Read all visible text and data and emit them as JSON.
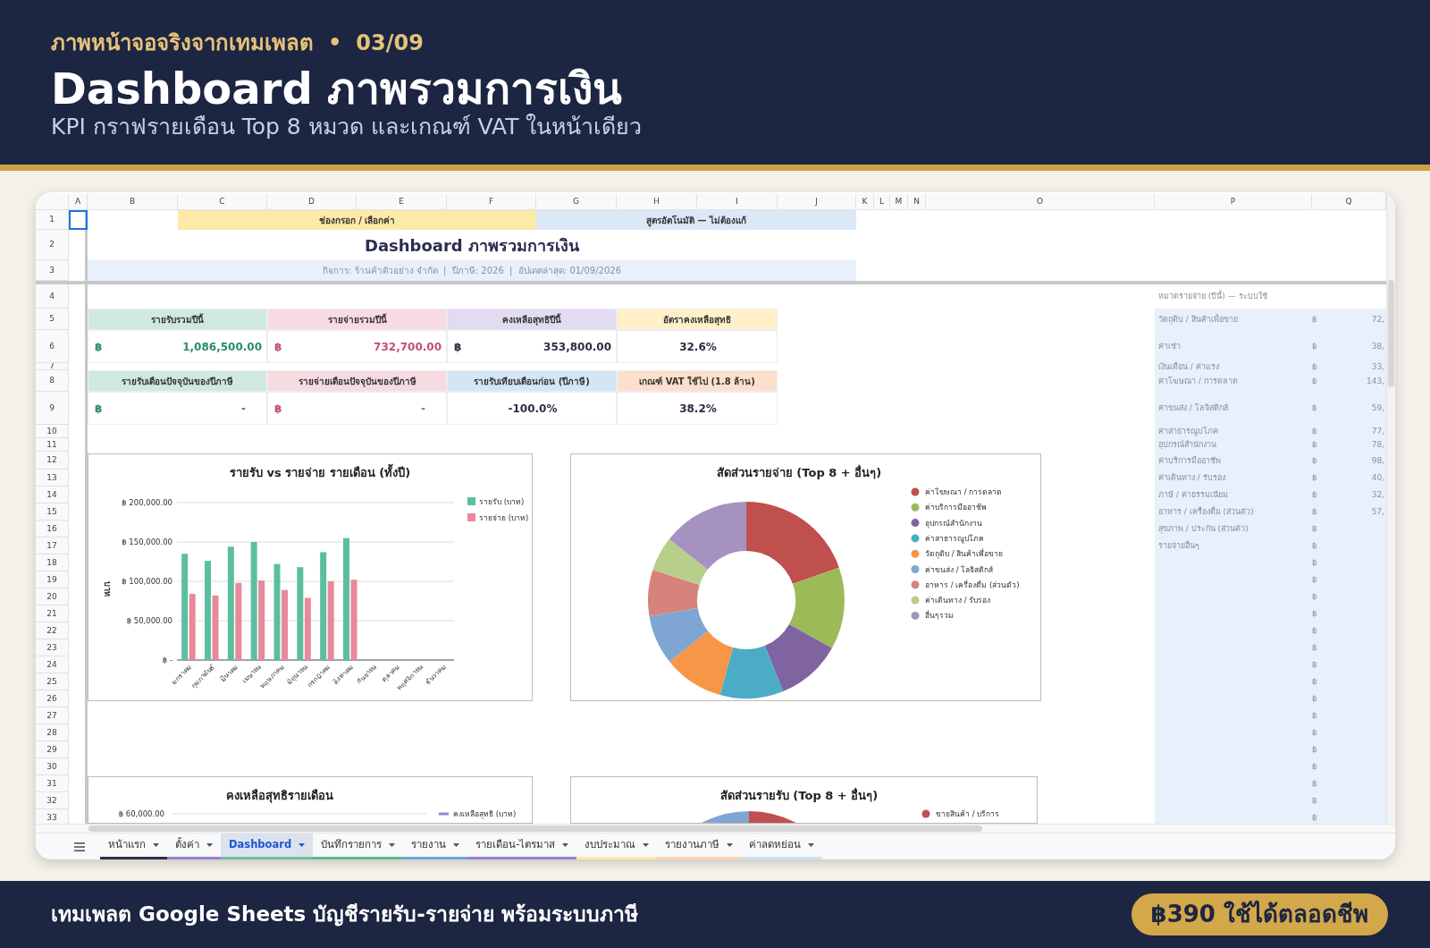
{
  "banner": {
    "kicker": "ภาพหน้าจอจริงจากเทมเพลต",
    "separator": "•",
    "counter": "03/09",
    "title": "Dashboard ภาพรวมการเงิน",
    "subtitle": "KPI กราฟรายเดือน Top 8 หมวด และเกณฑ์ VAT ในหน้าเดียว"
  },
  "sheet": {
    "columns": [
      "A",
      "B",
      "C",
      "D",
      "E",
      "F",
      "G",
      "H",
      "I",
      "J",
      "K",
      "L",
      "M",
      "N",
      "O",
      "P",
      "Q"
    ],
    "rows": [
      "1",
      "2",
      "3",
      "4",
      "5",
      "6",
      "7",
      "8",
      "9",
      "10",
      "11",
      "12",
      "13",
      "14",
      "15",
      "16",
      "17",
      "18",
      "19",
      "20",
      "21",
      "22",
      "23",
      "24",
      "25",
      "26",
      "27",
      "28",
      "29",
      "30",
      "31",
      "32",
      "33"
    ],
    "legend_cells": [
      {
        "text": "ช่องกรอก / เลือกค่า",
        "color": "#fde9a8"
      },
      {
        "text": "สูตรอัตโนมัติ — ไม่ต้องแก้",
        "color": "#dbe8f7"
      }
    ],
    "title": "Dashboard ภาพรวมการเงิน",
    "info": "กิจการ: ร้านค้าตัวอย่าง จำกัด  |  ปีภาษี: 2026  |  อัปเดตล่าสุด: 01/09/2026",
    "kpi_rows": [
      [
        {
          "label": "รายรับรวมปีนี้",
          "color": "#d0e9de",
          "kind": "income",
          "currency": "฿",
          "value": "1,086,500.00"
        },
        {
          "label": "รายจ่ายรวมปีนี้",
          "color": "#f8dbe1",
          "kind": "expense",
          "currency": "฿",
          "value": "732,700.00"
        },
        {
          "label": "คงเหลือสุทธิปีนี้",
          "color": "#e3dbf2",
          "kind": "plain",
          "currency": "฿",
          "value": "353,800.00"
        },
        {
          "label": "อัตราคงเหลือสุทธิ",
          "color": "#fff0c8",
          "kind": "plain",
          "value": "32.6%"
        }
      ],
      [
        {
          "label": "รายรับเดือนปัจจุบันของปีภาษี",
          "color": "#d0e9de",
          "kind": "income",
          "currency": "฿",
          "value": "-"
        },
        {
          "label": "รายจ่ายเดือนปัจจุบันของปีภาษี",
          "color": "#f8dbe1",
          "kind": "expense",
          "currency": "฿",
          "value": "-"
        },
        {
          "label": "รายรับเทียบเดือนก่อน (ปีภาษี)",
          "color": "#d4e6f4",
          "kind": "plain",
          "value": "-100.0%"
        },
        {
          "label": "เกณฑ์ VAT ใช้ไป (1.8 ล้าน)",
          "color": "#fde0cb",
          "kind": "plain",
          "value": "38.2%"
        }
      ]
    ],
    "charts": [
      {
        "kind": "bar",
        "chart_data": {
          "type": "bar",
          "title": "รายรับ vs รายจ่าย รายเดือน (ทั้งปี)",
          "ylabel": "บาท",
          "categories": [
            "มกราคม",
            "กุมภาพันธ์",
            "มีนาคม",
            "เมษายน",
            "พฤษภาคม",
            "มิถุนายน",
            "กรกฎาคม",
            "สิงหาคม",
            "กันยายน",
            "ตุลาคม",
            "พฤศจิกายน",
            "ธันวาคม"
          ],
          "series": [
            {
              "name": "รายรับ (บาท)",
              "color": "#5bbf9f",
              "values": [
                135000,
                126000,
                144000,
                150000,
                122000,
                118000,
                137000,
                155000,
                null,
                null,
                null,
                null
              ]
            },
            {
              "name": "รายจ่าย (บาท)",
              "color": "#e8899b",
              "values": [
                84000,
                82000,
                98000,
                101000,
                89000,
                79000,
                100000,
                102000,
                null,
                null,
                null,
                null
              ]
            }
          ],
          "ylim": [
            0,
            200000
          ],
          "grid": true,
          "legend": true,
          "yticks": [
            {
              "value": 0,
              "label": "฿ -"
            },
            {
              "value": 50000,
              "label": "฿ 50,000.00"
            },
            {
              "value": 100000,
              "label": "฿ 100,000.00"
            },
            {
              "value": 150000,
              "label": "฿ 150,000.00"
            },
            {
              "value": 200000,
              "label": "฿ 200,000.00"
            }
          ]
        }
      },
      {
        "kind": "donut",
        "title": "สัดส่วนรายจ่าย (Top 8 + อื่นๆ)",
        "legend": [
          {
            "label": "ค่าโฆษณา / การตลาด",
            "color": "#c0504d"
          },
          {
            "label": "ค่าบริการมืออาชีพ",
            "color": "#9bbb59"
          },
          {
            "label": "อุปกรณ์สำนักงาน",
            "color": "#8064a2"
          },
          {
            "label": "ค่าสาธารณูปโภค",
            "color": "#4bacc6"
          },
          {
            "label": "วัตถุดิบ / สินค้าเพื่อขาย",
            "color": "#f79646"
          },
          {
            "label": "ค่าขนส่ง / โลจิสติกส์",
            "color": "#7fa6d3"
          },
          {
            "label": "อาหาร / เครื่องดื่ม (ส่วนตัว)",
            "color": "#d6837c"
          },
          {
            "label": "ค่าเดินทาง / รับรอง",
            "color": "#b8cf8a"
          },
          {
            "label": "อื่นๆรวม",
            "color": "#a592c0"
          }
        ]
      },
      {
        "kind": "line",
        "title": "คงเหลือสุทธิรายเดือน",
        "ytick": "฿ 60,000.00",
        "legend": [
          {
            "label": "คงเหลือสุทธิ (บาท)",
            "color": "#9a84d6"
          }
        ]
      },
      {
        "kind": "donut_top",
        "title": "สัดส่วนรายรับ (Top 8 + อื่นๆ)",
        "legend": [
          {
            "label": "ขายสินค้า / บริการ",
            "color": "#c0504d"
          }
        ]
      }
    ],
    "side_panel": {
      "heading": "หมวดรายจ่าย (ปีนี้) — ระบบใช้",
      "items": [
        {
          "label": "วัตถุดิบ / สินค้าเพื่อขาย",
          "currency": "฿",
          "value": "72,"
        },
        {
          "label": "ค่าเช่า",
          "currency": "฿",
          "value": "38,"
        },
        {
          "label": "เงินเดือน / ค่าแรง",
          "currency": "฿",
          "value": "33,"
        },
        {
          "label": "ค่าโฆษณา / การตลาด",
          "currency": "฿",
          "value": "143,"
        },
        {
          "label": "ค่าขนส่ง / โลจิสติกส์",
          "currency": "฿",
          "value": "59,"
        },
        {
          "label": "ค่าสาธารณูปโภค",
          "currency": "฿",
          "value": "77,"
        },
        {
          "label": "อุปกรณ์สำนักงาน",
          "currency": "฿",
          "value": "78,"
        },
        {
          "label": "ค่าบริการมืออาชีพ",
          "currency": "฿",
          "value": "98,"
        },
        {
          "label": "ค่าเดินทาง / รับรอง",
          "currency": "฿",
          "value": "40,"
        },
        {
          "label": "ภาษี / ค่าธรรมเนียม",
          "currency": "฿",
          "value": "32,"
        },
        {
          "label": "อาหาร / เครื่องดื่ม (ส่วนตัว)",
          "currency": "฿",
          "value": "57,"
        },
        {
          "label": "สุขภาพ / ประกัน (ส่วนตัว)",
          "currency": "฿"
        },
        {
          "label": "รายจ่ายอื่นๆ",
          "currency": "฿"
        },
        {
          "currency": "฿"
        },
        {
          "currency": "฿"
        },
        {
          "currency": "฿"
        },
        {
          "currency": "฿"
        },
        {
          "currency": "฿"
        },
        {
          "currency": "฿"
        },
        {
          "currency": "฿"
        },
        {
          "currency": "฿"
        },
        {
          "currency": "฿"
        },
        {
          "currency": "฿"
        },
        {
          "currency": "฿"
        },
        {
          "currency": "฿"
        },
        {
          "currency": "฿"
        },
        {
          "currency": "฿"
        },
        {
          "currency": "฿"
        },
        {
          "currency": "฿"
        }
      ]
    }
  },
  "sheet_tabs": [
    {
      "label": "หน้าแรก",
      "color": "#2d2f45",
      "selected": false
    },
    {
      "label": "ตั้งค่า",
      "color": "#9b7fd4",
      "selected": false
    },
    {
      "label": "Dashboard",
      "color": "#6fbf9a",
      "selected": true
    },
    {
      "label": "บันทึกรายการ",
      "color": "#5cb88f",
      "selected": false
    },
    {
      "label": "รายงาน",
      "color": "#6fa8dc",
      "selected": false
    },
    {
      "label": "รายเดือน-ไตรมาส",
      "color": "#9b7fd4",
      "selected": false
    },
    {
      "label": "งบประมาณ",
      "color": "#fde9a8",
      "selected": false
    },
    {
      "label": "รายงานภาษี",
      "color": "#fbd5b5",
      "selected": false
    },
    {
      "label": "ค่าลดหย่อน",
      "color": "#cfe2f3",
      "selected": false
    }
  ],
  "footer": {
    "text": "เทมเพลต Google Sheets บัญชีรายรับ-รายจ่าย พร้อมระบบภาษี",
    "price": "฿390 ใช้ได้ตลอดชีพ"
  }
}
